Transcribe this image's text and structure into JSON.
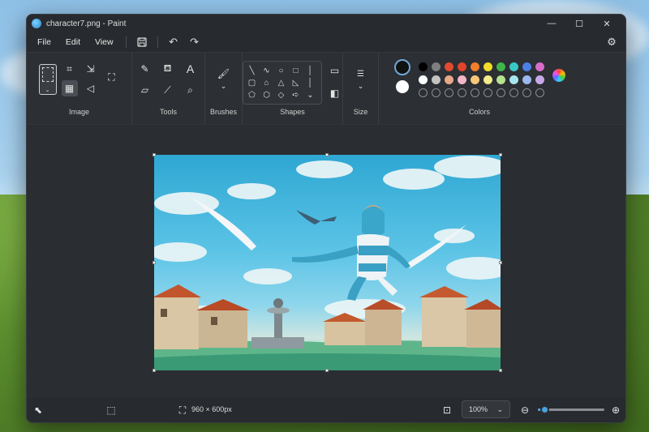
{
  "window": {
    "title": "character7.png - Paint",
    "controls": {
      "minimize": "—",
      "maximize": "☐",
      "close": "✕"
    }
  },
  "menu": {
    "items": [
      {
        "label": "File"
      },
      {
        "label": "Edit"
      },
      {
        "label": "View"
      }
    ]
  },
  "ribbon": {
    "groups": {
      "image": "Image",
      "tools": "Tools",
      "brushes": "Brushes",
      "shapes": "Shapes",
      "size": "Size",
      "colors": "Colors"
    },
    "text_tool_glyph": "A"
  },
  "palette": {
    "primary": "#111111",
    "secondary": "#ffffff",
    "row1": [
      "#000000",
      "#7f7f7f",
      "#e04a2f",
      "#e0442c",
      "#f07e2c",
      "#f2dc2a",
      "#3fb44a",
      "#3bc6c6",
      "#4d7fe6",
      "#d56cc9"
    ],
    "row2": [
      "#ffffff",
      "#c3c3c3",
      "#e8a88a",
      "#f2b6c6",
      "#f5c77a",
      "#f4ec8a",
      "#b5e28c",
      "#a6e5ee",
      "#9bb8ef",
      "#c8a8e8"
    ]
  },
  "status": {
    "image_size": "960 × 600px",
    "zoom_value": "100%",
    "zoom_level": 0.1
  },
  "colors": {
    "accent": "#4aa3df",
    "window_bg": "#272a2e",
    "ribbon_bg": "#2c2f33"
  }
}
